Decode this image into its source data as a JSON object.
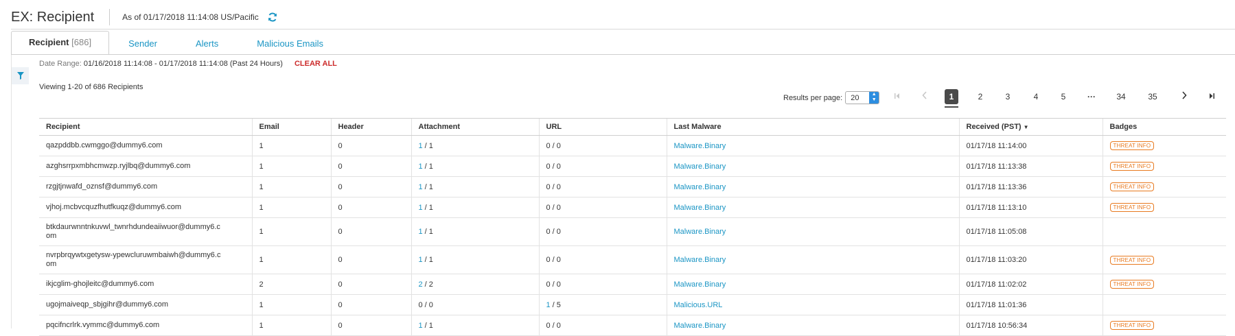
{
  "header": {
    "title": "EX: Recipient",
    "as_of": "As of 01/17/2018 11:14:08 US/Pacific"
  },
  "tabs": [
    {
      "label": "Recipient",
      "count": "[686]",
      "active": true
    },
    {
      "label": "Sender"
    },
    {
      "label": "Alerts"
    },
    {
      "label": "Malicious Emails"
    }
  ],
  "date_range": {
    "label": "Date Range:",
    "value": "01/16/2018 11:14:08 - 01/17/2018 11:14:08 (Past 24 Hours)",
    "clear_label": "CLEAR ALL"
  },
  "viewing": "Viewing 1-20 of 686 Recipients",
  "results_per_page": {
    "label": "Results per page:",
    "value": "20"
  },
  "pagination": {
    "pages": [
      "1",
      "2",
      "3",
      "4",
      "5",
      "···",
      "34",
      "35"
    ],
    "current": "1"
  },
  "table": {
    "columns": [
      "Recipient",
      "Email",
      "Header",
      "Attachment",
      "URL",
      "Last Malware",
      "Received (PST)",
      "Badges"
    ],
    "rows": [
      {
        "recipient": "qazpddbb.cwmggo@dummy6.com",
        "email": "1",
        "header": "0",
        "att_a": "1",
        "att_b": " / 1",
        "url_a": "0",
        "url_b": " / 0",
        "malware": "Malware.Binary",
        "received": "01/17/18 11:14:00",
        "badge": "THREAT INFO"
      },
      {
        "recipient": "azghsrrpxmbhcmwzp.ryjlbq@dummy6.com",
        "email": "1",
        "header": "0",
        "att_a": "1",
        "att_b": " / 1",
        "url_a": "0",
        "url_b": " / 0",
        "malware": "Malware.Binary",
        "received": "01/17/18 11:13:38",
        "badge": "THREAT INFO"
      },
      {
        "recipient": "rzgjtjnwafd_oznsf@dummy6.com",
        "email": "1",
        "header": "0",
        "att_a": "1",
        "att_b": " / 1",
        "url_a": "0",
        "url_b": " / 0",
        "malware": "Malware.Binary",
        "received": "01/17/18 11:13:36",
        "badge": "THREAT INFO"
      },
      {
        "recipient": "vjhoj.mcbvcquzfhutfkuqz@dummy6.com",
        "email": "1",
        "header": "0",
        "att_a": "1",
        "att_b": " / 1",
        "url_a": "0",
        "url_b": " / 0",
        "malware": "Malware.Binary",
        "received": "01/17/18 11:13:10",
        "badge": "THREAT INFO"
      },
      {
        "recipient": "btkdaurwnntnkuvwl_twnrhdundeaiiwuor@dummy6.com",
        "email": "1",
        "header": "0",
        "att_a": "1",
        "att_b": " / 1",
        "url_a": "0",
        "url_b": " / 0",
        "malware": "Malware.Binary",
        "received": "01/17/18 11:05:08",
        "badge": ""
      },
      {
        "recipient": "nvrpbrqywtxgetysw-ypewcluruwmbaiwh@dummy6.com",
        "email": "1",
        "header": "0",
        "att_a": "1",
        "att_b": " / 1",
        "url_a": "0",
        "url_b": " / 0",
        "malware": "Malware.Binary",
        "received": "01/17/18 11:03:20",
        "badge": "THREAT INFO"
      },
      {
        "recipient": "ikjcglim-ghojleitc@dummy6.com",
        "email": "2",
        "header": "0",
        "att_a": "2",
        "att_b": " / 2",
        "url_a": "0",
        "url_b": " / 0",
        "malware": "Malware.Binary",
        "received": "01/17/18 11:02:02",
        "badge": "THREAT INFO"
      },
      {
        "recipient": "ugojmaiveqp_sbjgihr@dummy6.com",
        "email": "1",
        "header": "0",
        "att_a": "0",
        "att_b": " / 0",
        "url_a": "1",
        "url_b": " / 5",
        "malware": "Malicious.URL",
        "received": "01/17/18 11:01:36",
        "badge": ""
      },
      {
        "recipient": "pqcifncrlrk.vymmc@dummy6.com",
        "email": "1",
        "header": "0",
        "att_a": "1",
        "att_b": " / 1",
        "url_a": "0",
        "url_b": " / 0",
        "malware": "Malware.Binary",
        "received": "01/17/18 10:56:34",
        "badge": "THREAT INFO"
      }
    ]
  },
  "colors": {
    "accent": "#1a95c4",
    "clear": "#cc2b2b",
    "badge": "#e8791e"
  },
  "icons": {
    "refresh": "refresh-icon",
    "filter": "filter-icon"
  }
}
